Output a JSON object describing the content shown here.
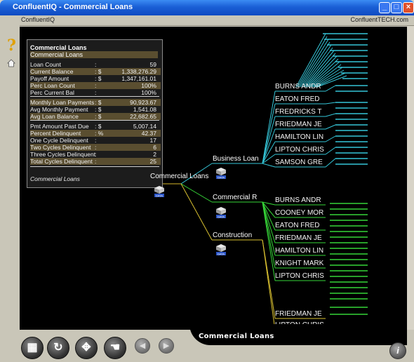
{
  "window": {
    "title": "ConfluentIQ - Commercial Loans",
    "app_name": "ConfluentIQ",
    "company": "ConfluentTECH.com"
  },
  "stats_panel": {
    "title": "Commercial Loans",
    "subtitle": "Commercial Loans",
    "footer": "Commercial Loans",
    "rows": [
      {
        "label": "Loan Count",
        "sep": ":",
        "val": "59"
      },
      {
        "label": "Current Balance",
        "sep": ": $",
        "val": "1,338,276.29"
      },
      {
        "label": "Payoff Amount",
        "sep": ": $",
        "val": "1,347,161.01"
      },
      {
        "label": "Perc Loan Count",
        "sep": ":",
        "val": "100%"
      },
      {
        "label": "Perc Current Bal",
        "sep": ":",
        "val": "100%"
      },
      {
        "label": "Monthly Loan Payments",
        "sep": ": $",
        "val": "90,923.67"
      },
      {
        "label": "Avg Monthly Payment",
        "sep": ": $",
        "val": "1,541.08"
      },
      {
        "label": "Avg Loan Balance",
        "sep": ": $",
        "val": "22,682.65"
      },
      {
        "label": "Pmt Amount Past Due",
        "sep": ": $",
        "val": "5,007.14"
      },
      {
        "label": "Percent Delinquent",
        "sep": ": %",
        "val": "42.37"
      },
      {
        "label": "One Cycle Delinquent",
        "sep": ":",
        "val": "17"
      },
      {
        "label": "Two Cycles Delinquent",
        "sep": ":",
        "val": "6"
      },
      {
        "label": "Three Cycles Delinquent",
        "sep": ":",
        "val": "2"
      },
      {
        "label": "Total Cycles Delinquent",
        "sep": ":",
        "val": "25"
      }
    ]
  },
  "tree": {
    "root": "Commercial Loans",
    "data_badge": "DATA",
    "branches": {
      "business": "Business Loan",
      "commercial": "Commercial R",
      "construction": "Construction"
    },
    "business_names": [
      "BURNS ANDR",
      "EATON FRED",
      "FREDRICKS T",
      "FRIEDMAN JE",
      "HAMILTON LIN",
      "LIPTON CHRIS",
      "SAMSON GRE"
    ],
    "commercial_names": [
      "BURNS ANDR",
      "COONEY MOR",
      "EATON FRED",
      "FRIEDMAN JE",
      "HAMILTON LIN",
      "KNIGHT MARK",
      "LIPTON CHRIS"
    ],
    "construction_names": [
      "FRIEDMAN JE",
      "LIPTON CHRIS"
    ]
  },
  "caption": "Commercial Loans",
  "colors": {
    "business_branch": "#35c6d8",
    "commercial_branch": "#36d638",
    "construction_branch": "#d8c030",
    "root_branch": "#d6b82a"
  },
  "toolbar": {
    "buttons": [
      "layout-icon",
      "refresh-icon",
      "move-icon",
      "pointer-icon",
      "back-icon",
      "forward-icon"
    ],
    "help_glyph": "?",
    "info_glyph": "i"
  }
}
